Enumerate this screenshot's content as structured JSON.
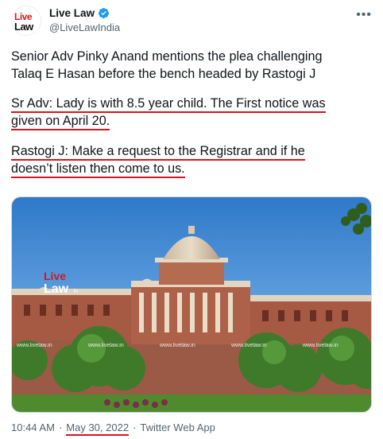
{
  "author": {
    "display_name": "Live Law",
    "handle": "@LiveLawIndia",
    "avatar_text_top": "Live",
    "avatar_text_bottom": "Law"
  },
  "tweet": {
    "p1_line1": "Senior Adv Pinky Anand mentions the plea challenging",
    "p1_line2": "Talaq E Hasan before the bench headed by Rastogi J",
    "p2_line1": "Sr Adv: Lady is with 8.5 year child. The First notice was",
    "p2_line2": "given on April 20.",
    "p3_line1": "Rastogi J: Make a request to the Registrar and if he",
    "p3_line2": "doesn’t listen then come to us."
  },
  "image": {
    "watermark_logo_top": "Live",
    "watermark_logo_bottom": "Law",
    "watermark_suffix": ".in",
    "watermark_text": "www.livelaw.in"
  },
  "meta": {
    "time": "10:44 AM",
    "sep1": "·",
    "date": "May 30, 2022",
    "sep2": "·",
    "source": "Twitter Web App"
  },
  "colors": {
    "underline": "#d3161f",
    "verified": "#1d9bf0",
    "brand_red": "#d0191f"
  },
  "icons": [
    "more-icon",
    "verified-icon"
  ]
}
